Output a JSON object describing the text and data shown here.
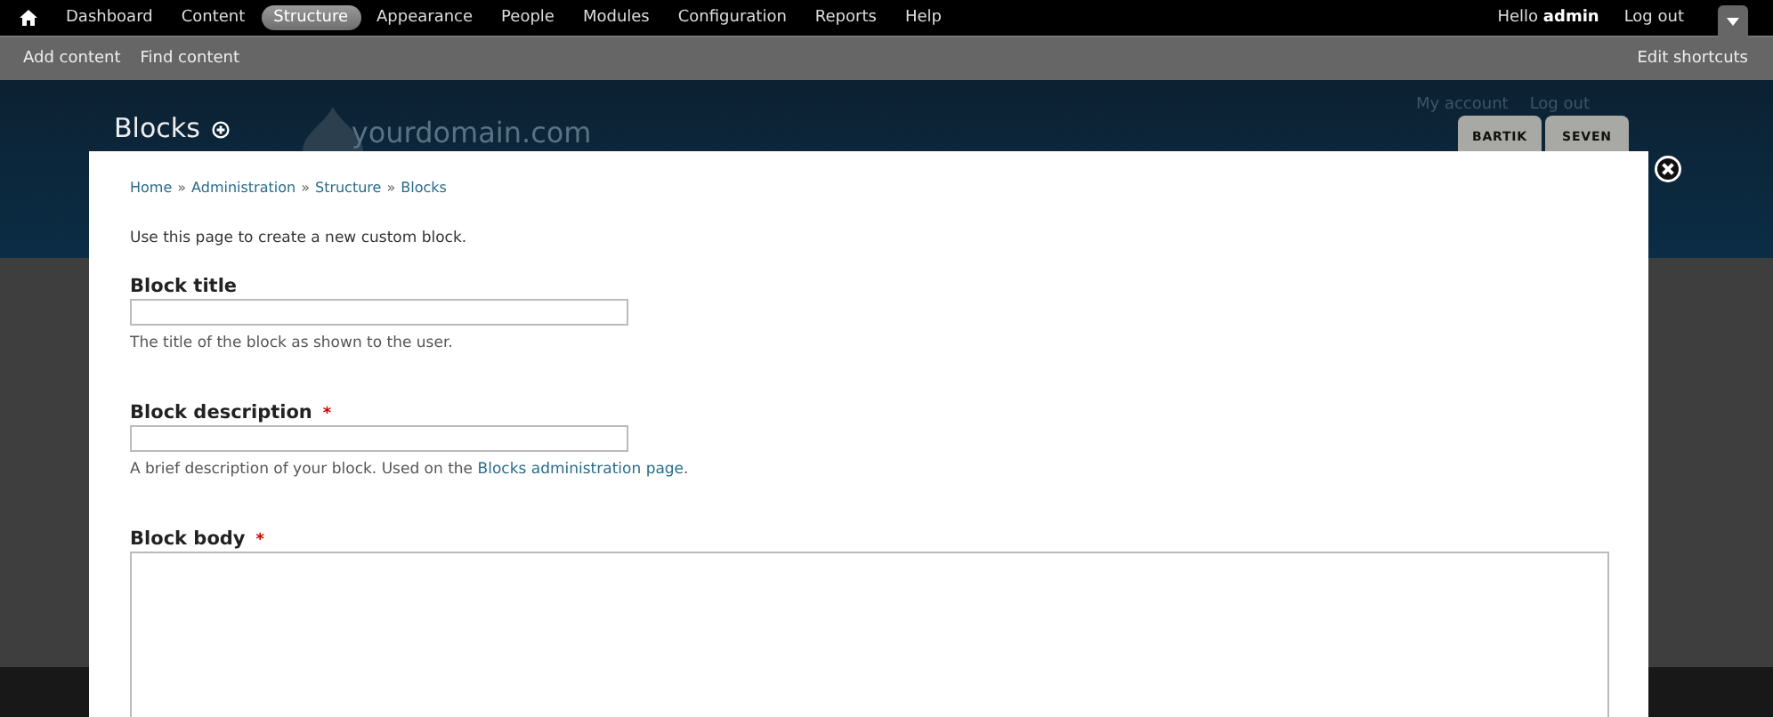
{
  "toolbar": {
    "menu": [
      {
        "label": "Dashboard",
        "selected": false
      },
      {
        "label": "Content",
        "selected": false
      },
      {
        "label": "Structure",
        "selected": true
      },
      {
        "label": "Appearance",
        "selected": false
      },
      {
        "label": "People",
        "selected": false
      },
      {
        "label": "Modules",
        "selected": false
      },
      {
        "label": "Configuration",
        "selected": false
      },
      {
        "label": "Reports",
        "selected": false
      },
      {
        "label": "Help",
        "selected": false
      }
    ],
    "greeting": "Hello",
    "username": "admin",
    "logout": "Log out"
  },
  "shortcuts": {
    "items": [
      "Add content",
      "Find content"
    ],
    "edit": "Edit shortcuts"
  },
  "header": {
    "title": "Blocks",
    "site_name": "yourdomain.com",
    "secondary_links": [
      "My account",
      "Log out"
    ],
    "theme_tabs": [
      "BARTIK",
      "SEVEN"
    ]
  },
  "overlay": {
    "breadcrumb": [
      "Home",
      "Administration",
      "Structure",
      "Blocks"
    ],
    "separator": "»",
    "intro": "Use this page to create a new custom block.",
    "required_mark": "*",
    "fields": [
      {
        "kind": "text",
        "label": "Block title",
        "required": false,
        "description": "The title of the block as shown to the user."
      },
      {
        "kind": "text",
        "label": "Block description",
        "required": true,
        "description": "A brief description of your block. Used on the ",
        "link": "Blocks administration page",
        "after": "."
      },
      {
        "kind": "textarea",
        "label": "Block body",
        "required": true
      }
    ]
  }
}
